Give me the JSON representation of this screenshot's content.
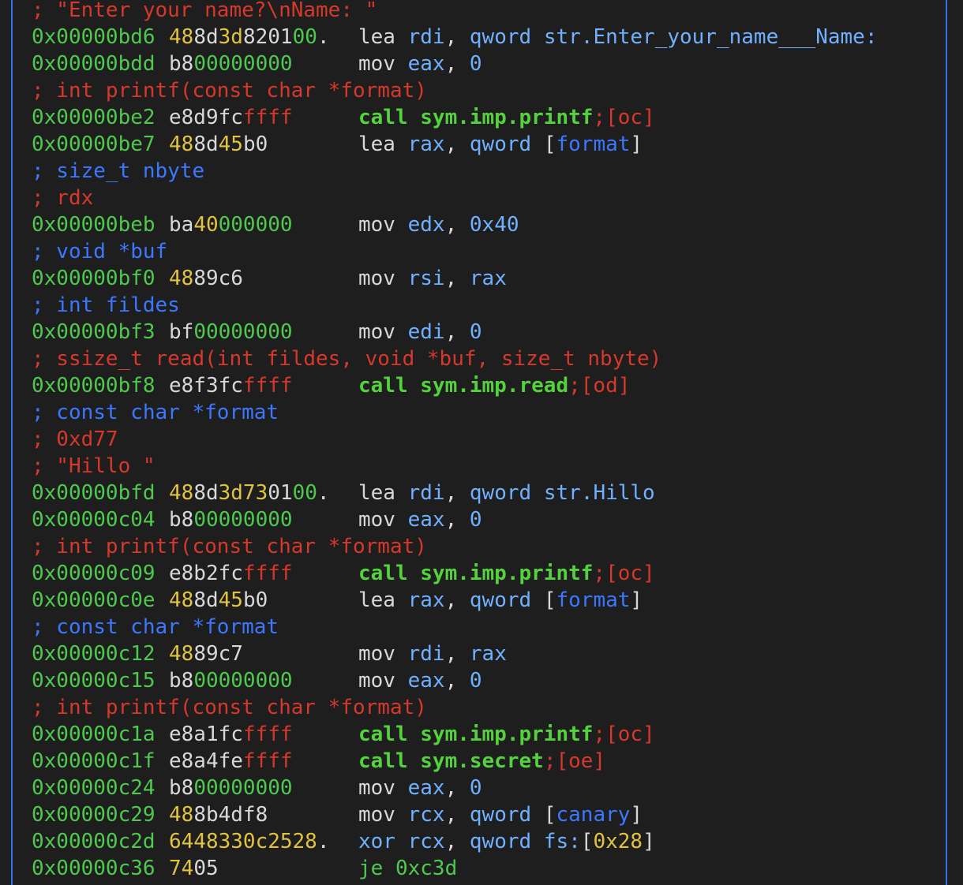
{
  "colors": {
    "background": "#1e1e1e",
    "comment_red": "#d6382b",
    "comment_blue": "#3b78ff",
    "address_green": "#4ec94e",
    "byte_yellow": "#e0c341",
    "text_white": "#d8d8d8",
    "register_blue": "#6fb1ff",
    "call_green": "#54d23d",
    "border_blue": "#3a6cf0"
  },
  "lines": [
    {
      "type": "comment",
      "tokens": [
        {
          "t": "; \"Enter your name?\\nName: \"",
          "c": "red"
        }
      ]
    },
    {
      "type": "instr",
      "addr": "0x00000bd6",
      "bytes": [
        {
          "t": "48",
          "c": "yellow"
        },
        {
          "t": "8d",
          "c": "white"
        },
        {
          "t": "3d",
          "c": "yellow"
        },
        {
          "t": "8201",
          "c": "white"
        },
        {
          "t": "00",
          "c": "green"
        },
        {
          "t": ".",
          "c": "white"
        }
      ],
      "instr": [
        {
          "t": "lea ",
          "c": "white"
        },
        {
          "t": "rdi",
          "c": "reg"
        },
        {
          "t": ", ",
          "c": "white"
        },
        {
          "t": "qword ",
          "c": "reg"
        },
        {
          "t": "str.Enter_your_name___Name:",
          "c": "reg"
        }
      ]
    },
    {
      "type": "instr",
      "addr": "0x00000bdd",
      "bytes": [
        {
          "t": "b8",
          "c": "white"
        },
        {
          "t": "00000000",
          "c": "green"
        }
      ],
      "instr": [
        {
          "t": "mov ",
          "c": "white"
        },
        {
          "t": "eax",
          "c": "reg"
        },
        {
          "t": ", ",
          "c": "white"
        },
        {
          "t": "0",
          "c": "reg"
        }
      ]
    },
    {
      "type": "comment",
      "tokens": [
        {
          "t": "; int printf(const char *format)",
          "c": "red"
        }
      ]
    },
    {
      "type": "instr",
      "addr": "0x00000be2",
      "bytes": [
        {
          "t": "e8d9fc",
          "c": "white"
        },
        {
          "t": "ffff",
          "c": "red"
        }
      ],
      "instr": [
        {
          "t": "call sym.imp.printf",
          "c": "call"
        },
        {
          "t": ";[oc]",
          "c": "red"
        }
      ]
    },
    {
      "type": "instr",
      "addr": "0x00000be7",
      "bytes": [
        {
          "t": "48",
          "c": "yellow"
        },
        {
          "t": "8d",
          "c": "white"
        },
        {
          "t": "45",
          "c": "yellow"
        },
        {
          "t": "b0",
          "c": "white"
        }
      ],
      "instr": [
        {
          "t": "lea ",
          "c": "white"
        },
        {
          "t": "rax",
          "c": "reg"
        },
        {
          "t": ", ",
          "c": "white"
        },
        {
          "t": "qword ",
          "c": "reg"
        },
        {
          "t": "[",
          "c": "white"
        },
        {
          "t": "format",
          "c": "blue"
        },
        {
          "t": "]",
          "c": "white"
        }
      ]
    },
    {
      "type": "comment",
      "tokens": [
        {
          "t": "; size_t nbyte",
          "c": "blue"
        }
      ]
    },
    {
      "type": "comment",
      "tokens": [
        {
          "t": "; rdx",
          "c": "red"
        }
      ]
    },
    {
      "type": "instr",
      "addr": "0x00000beb",
      "bytes": [
        {
          "t": "ba",
          "c": "white"
        },
        {
          "t": "40",
          "c": "yellow"
        },
        {
          "t": "000000",
          "c": "green"
        }
      ],
      "instr": [
        {
          "t": "mov ",
          "c": "white"
        },
        {
          "t": "edx",
          "c": "reg"
        },
        {
          "t": ", ",
          "c": "white"
        },
        {
          "t": "0x40",
          "c": "reg"
        }
      ]
    },
    {
      "type": "comment",
      "tokens": [
        {
          "t": "; void *buf",
          "c": "blue"
        }
      ]
    },
    {
      "type": "instr",
      "addr": "0x00000bf0",
      "bytes": [
        {
          "t": "48",
          "c": "yellow"
        },
        {
          "t": "89c6",
          "c": "white"
        }
      ],
      "instr": [
        {
          "t": "mov ",
          "c": "white"
        },
        {
          "t": "rsi",
          "c": "reg"
        },
        {
          "t": ", ",
          "c": "white"
        },
        {
          "t": "rax",
          "c": "reg"
        }
      ]
    },
    {
      "type": "comment",
      "tokens": [
        {
          "t": "; int fildes",
          "c": "blue"
        }
      ]
    },
    {
      "type": "instr",
      "addr": "0x00000bf3",
      "bytes": [
        {
          "t": "bf",
          "c": "white"
        },
        {
          "t": "00000000",
          "c": "green"
        }
      ],
      "instr": [
        {
          "t": "mov ",
          "c": "white"
        },
        {
          "t": "edi",
          "c": "reg"
        },
        {
          "t": ", ",
          "c": "white"
        },
        {
          "t": "0",
          "c": "reg"
        }
      ]
    },
    {
      "type": "comment",
      "tokens": [
        {
          "t": "; ssize_t read(int fildes, void *buf, size_t nbyte)",
          "c": "red"
        }
      ]
    },
    {
      "type": "instr",
      "addr": "0x00000bf8",
      "bytes": [
        {
          "t": "e8f3fc",
          "c": "white"
        },
        {
          "t": "ffff",
          "c": "red"
        }
      ],
      "instr": [
        {
          "t": "call sym.imp.read",
          "c": "call"
        },
        {
          "t": ";[od]",
          "c": "red"
        }
      ]
    },
    {
      "type": "comment",
      "tokens": [
        {
          "t": "; const char *format",
          "c": "blue"
        }
      ]
    },
    {
      "type": "comment",
      "tokens": [
        {
          "t": "; 0xd77",
          "c": "red"
        }
      ]
    },
    {
      "type": "comment",
      "tokens": [
        {
          "t": "; \"Hillo \"",
          "c": "red"
        }
      ]
    },
    {
      "type": "instr",
      "addr": "0x00000bfd",
      "bytes": [
        {
          "t": "48",
          "c": "yellow"
        },
        {
          "t": "8d",
          "c": "white"
        },
        {
          "t": "3d73",
          "c": "yellow"
        },
        {
          "t": "01",
          "c": "white"
        },
        {
          "t": "00",
          "c": "green"
        },
        {
          "t": ".",
          "c": "white"
        }
      ],
      "instr": [
        {
          "t": "lea ",
          "c": "white"
        },
        {
          "t": "rdi",
          "c": "reg"
        },
        {
          "t": ", ",
          "c": "white"
        },
        {
          "t": "qword ",
          "c": "reg"
        },
        {
          "t": "str.Hillo",
          "c": "reg"
        }
      ]
    },
    {
      "type": "instr",
      "addr": "0x00000c04",
      "bytes": [
        {
          "t": "b8",
          "c": "white"
        },
        {
          "t": "00000000",
          "c": "green"
        }
      ],
      "instr": [
        {
          "t": "mov ",
          "c": "white"
        },
        {
          "t": "eax",
          "c": "reg"
        },
        {
          "t": ", ",
          "c": "white"
        },
        {
          "t": "0",
          "c": "reg"
        }
      ]
    },
    {
      "type": "comment",
      "tokens": [
        {
          "t": "; int printf(const char *format)",
          "c": "red"
        }
      ]
    },
    {
      "type": "instr",
      "addr": "0x00000c09",
      "bytes": [
        {
          "t": "e8b2fc",
          "c": "white"
        },
        {
          "t": "ffff",
          "c": "red"
        }
      ],
      "instr": [
        {
          "t": "call sym.imp.printf",
          "c": "call"
        },
        {
          "t": ";[oc]",
          "c": "red"
        }
      ]
    },
    {
      "type": "instr",
      "addr": "0x00000c0e",
      "bytes": [
        {
          "t": "48",
          "c": "yellow"
        },
        {
          "t": "8d",
          "c": "white"
        },
        {
          "t": "45",
          "c": "yellow"
        },
        {
          "t": "b0",
          "c": "white"
        }
      ],
      "instr": [
        {
          "t": "lea ",
          "c": "white"
        },
        {
          "t": "rax",
          "c": "reg"
        },
        {
          "t": ", ",
          "c": "white"
        },
        {
          "t": "qword ",
          "c": "reg"
        },
        {
          "t": "[",
          "c": "white"
        },
        {
          "t": "format",
          "c": "blue"
        },
        {
          "t": "]",
          "c": "white"
        }
      ]
    },
    {
      "type": "comment",
      "tokens": [
        {
          "t": "; const char *format",
          "c": "blue"
        }
      ]
    },
    {
      "type": "instr",
      "addr": "0x00000c12",
      "bytes": [
        {
          "t": "48",
          "c": "yellow"
        },
        {
          "t": "89c7",
          "c": "white"
        }
      ],
      "instr": [
        {
          "t": "mov ",
          "c": "white"
        },
        {
          "t": "rdi",
          "c": "reg"
        },
        {
          "t": ", ",
          "c": "white"
        },
        {
          "t": "rax",
          "c": "reg"
        }
      ]
    },
    {
      "type": "instr",
      "addr": "0x00000c15",
      "bytes": [
        {
          "t": "b8",
          "c": "white"
        },
        {
          "t": "00000000",
          "c": "green"
        }
      ],
      "instr": [
        {
          "t": "mov ",
          "c": "white"
        },
        {
          "t": "eax",
          "c": "reg"
        },
        {
          "t": ", ",
          "c": "white"
        },
        {
          "t": "0",
          "c": "reg"
        }
      ]
    },
    {
      "type": "comment",
      "tokens": [
        {
          "t": "; int printf(const char *format)",
          "c": "red"
        }
      ]
    },
    {
      "type": "instr",
      "addr": "0x00000c1a",
      "bytes": [
        {
          "t": "e8a1fc",
          "c": "white"
        },
        {
          "t": "ffff",
          "c": "red"
        }
      ],
      "instr": [
        {
          "t": "call sym.imp.printf",
          "c": "call"
        },
        {
          "t": ";[oc]",
          "c": "red"
        }
      ]
    },
    {
      "type": "instr",
      "addr": "0x00000c1f",
      "bytes": [
        {
          "t": "e8a4fe",
          "c": "white"
        },
        {
          "t": "ffff",
          "c": "red"
        }
      ],
      "instr": [
        {
          "t": "call sym.secret",
          "c": "call"
        },
        {
          "t": ";[oe]",
          "c": "red"
        }
      ]
    },
    {
      "type": "instr",
      "addr": "0x00000c24",
      "bytes": [
        {
          "t": "b8",
          "c": "white"
        },
        {
          "t": "00000000",
          "c": "green"
        }
      ],
      "instr": [
        {
          "t": "mov ",
          "c": "white"
        },
        {
          "t": "eax",
          "c": "reg"
        },
        {
          "t": ", ",
          "c": "white"
        },
        {
          "t": "0",
          "c": "reg"
        }
      ]
    },
    {
      "type": "instr",
      "addr": "0x00000c29",
      "bytes": [
        {
          "t": "48",
          "c": "yellow"
        },
        {
          "t": "8b4df8",
          "c": "white"
        }
      ],
      "instr": [
        {
          "t": "mov ",
          "c": "white"
        },
        {
          "t": "rcx",
          "c": "reg"
        },
        {
          "t": ", ",
          "c": "white"
        },
        {
          "t": "qword ",
          "c": "reg"
        },
        {
          "t": "[",
          "c": "white"
        },
        {
          "t": "canary",
          "c": "blue"
        },
        {
          "t": "]",
          "c": "white"
        }
      ]
    },
    {
      "type": "instr",
      "addr": "0x00000c2d",
      "bytes": [
        {
          "t": "6448330c2528",
          "c": "yellow"
        },
        {
          "t": ".",
          "c": "white"
        }
      ],
      "instr": [
        {
          "t": "xor ",
          "c": "reg"
        },
        {
          "t": "rcx",
          "c": "reg"
        },
        {
          "t": ", ",
          "c": "white"
        },
        {
          "t": "qword ",
          "c": "reg"
        },
        {
          "t": "fs:",
          "c": "reg"
        },
        {
          "t": "[",
          "c": "white"
        },
        {
          "t": "0x28",
          "c": "yellow"
        },
        {
          "t": "]",
          "c": "white"
        }
      ]
    },
    {
      "type": "instr",
      "addr": "0x00000c36",
      "bytes": [
        {
          "t": "74",
          "c": "yellow"
        },
        {
          "t": "05",
          "c": "white"
        }
      ],
      "instr": [
        {
          "t": "je 0xc3d",
          "c": "green"
        }
      ]
    }
  ]
}
